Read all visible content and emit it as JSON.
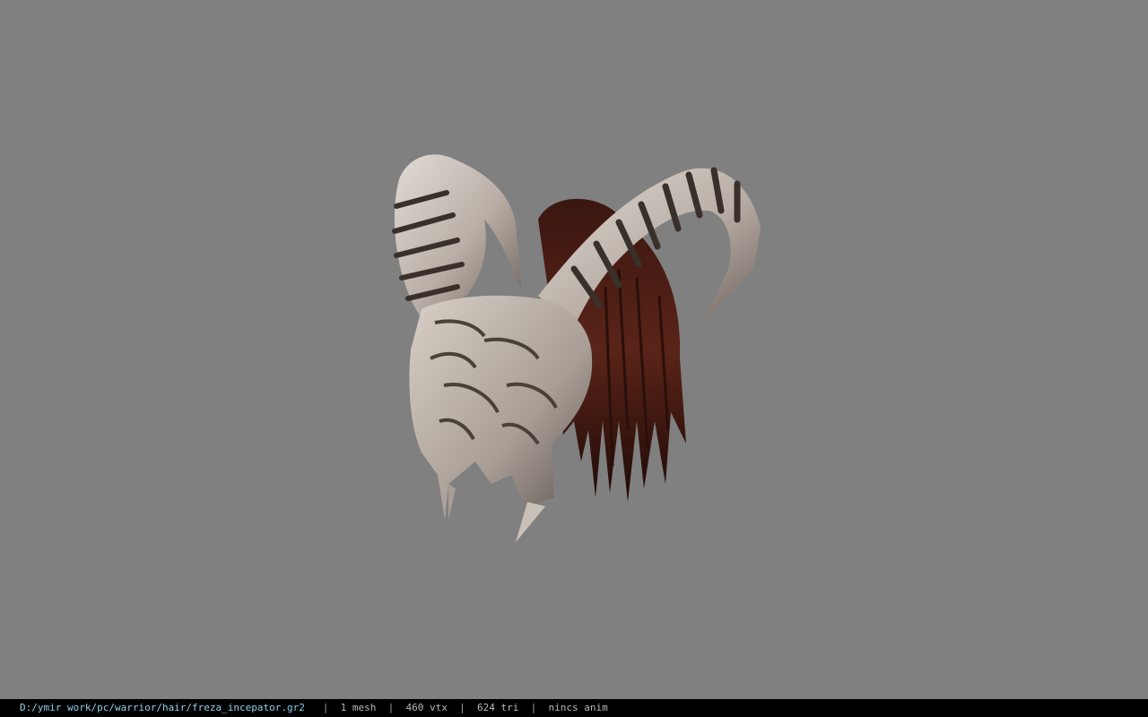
{
  "viewer": {
    "background_color": "#808080",
    "model": {
      "name": "horned-helmet-with-hair",
      "horn_color": "#c9c0b8",
      "stripe_color": "#3a302b",
      "hair_color": "#4a1c14"
    }
  },
  "status_bar": {
    "file_path": "D:/ymir work/pc/warrior/hair/freza_incepator.gr2",
    "separator": "|",
    "mesh_count": "1 mesh",
    "vertex_count": "460 vtx",
    "triangle_count": "624 tri",
    "anim_status": "nincs anim"
  }
}
